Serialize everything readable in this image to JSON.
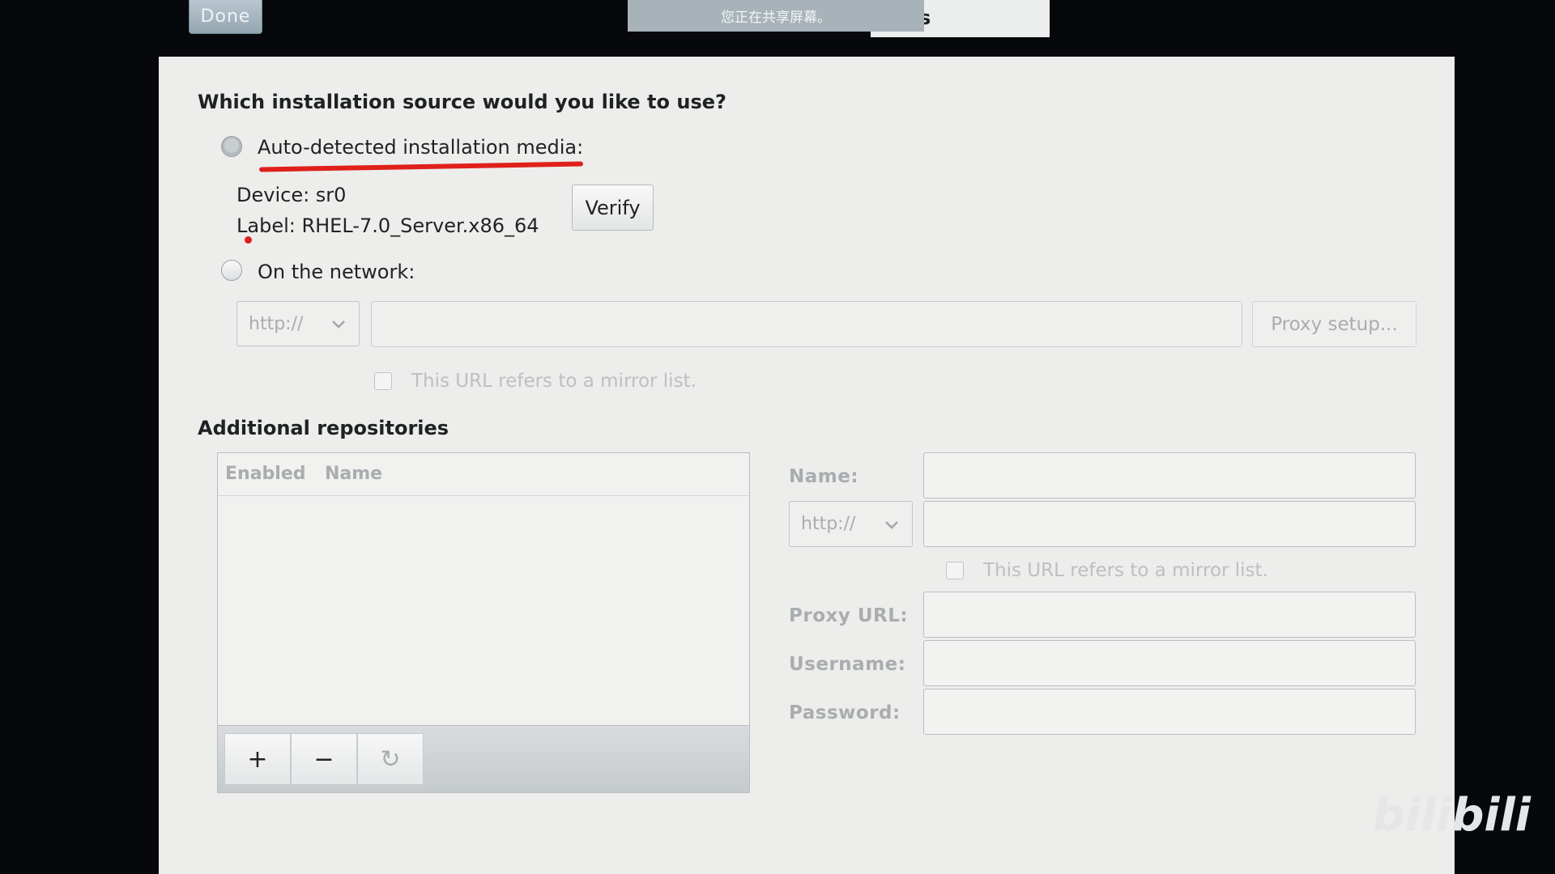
{
  "chrome": {
    "done_label": "Done",
    "title_fragment": "s",
    "share_banner": "您正在共享屏幕。"
  },
  "source": {
    "question": "Which installation source would you like to use?",
    "auto_label": "Auto-detected installation media:",
    "device_text": "Device: sr0",
    "label_text": "Label: RHEL-7.0_Server.x86_64",
    "verify_label": "Verify",
    "network_label": "On the network:",
    "protocol_value": "http://",
    "url_value": "",
    "proxy_label": "Proxy setup...",
    "mirror_label": "This URL refers to a mirror list."
  },
  "repos": {
    "heading": "Additional repositories",
    "col_enabled": "Enabled",
    "col_name": "Name",
    "add_label": "+",
    "remove_label": "−",
    "refresh_label": "↻",
    "form": {
      "name_label": "Name:",
      "protocol_value": "http://",
      "mirror_label": "This URL refers to a mirror list.",
      "proxy_url_label": "Proxy URL:",
      "username_label": "Username:",
      "password_label": "Password:"
    }
  },
  "watermark": "bilibili",
  "colors": {
    "annotation_red": "#e0201a",
    "panel_bg": "#ededec",
    "backdrop": "#06080b"
  }
}
